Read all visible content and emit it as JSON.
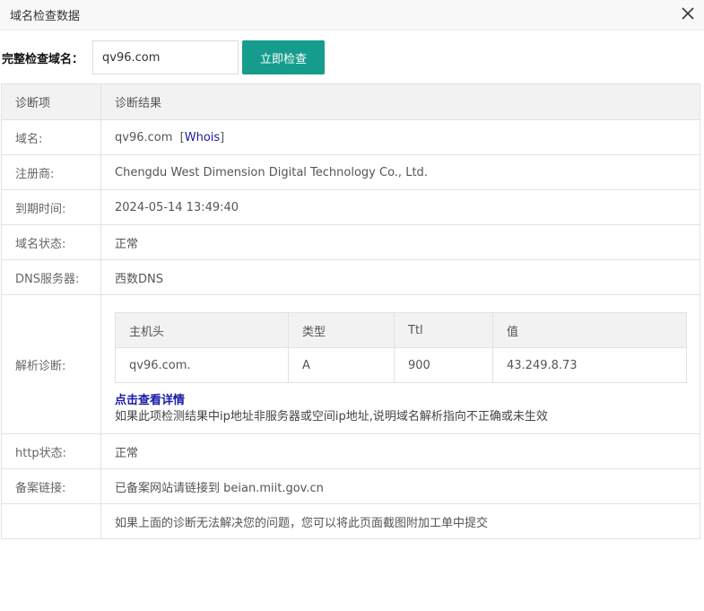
{
  "dialog": {
    "title": "域名检查数据",
    "close_icon": "close-icon"
  },
  "query": {
    "label": "完整检查域名：",
    "domain_value": "qv96.com",
    "button_label": "立即检查",
    "accent_color": "#169c8c"
  },
  "table": {
    "headers": [
      "诊断项",
      "诊断结果"
    ],
    "domain": {
      "label": "域名:",
      "value": "qv96.com",
      "whois_open": "[",
      "whois_label": "Whois",
      "whois_close": "]"
    },
    "registrar": {
      "label": "注册商:",
      "value": "Chengdu West Dimension Digital Technology Co., Ltd."
    },
    "expiry": {
      "label": "到期时间:",
      "value": "2024-05-14 13:49:40"
    },
    "status": {
      "label": "域名状态:",
      "value": "正常",
      "color": "#1b7a1b"
    },
    "dns_server": {
      "label": "DNS服务器:",
      "value": "西数DNS"
    },
    "resolution": {
      "label": "解析诊断:",
      "columns": [
        "主机头",
        "类型",
        "Ttl",
        "值"
      ],
      "rows": [
        {
          "host": "qv96.com.",
          "type": "A",
          "ttl": "900",
          "value": "43.249.8.73"
        }
      ],
      "details_link": "点击查看详情",
      "hint": "如果此项检测结果中ip地址非服务器或空间ip地址,说明域名解析指向不正确或未生效"
    },
    "http_status": {
      "label": "http状态:",
      "value": "正常"
    },
    "beian": {
      "label": "备案链接:",
      "value": "已备案网站请链接到 beian.miit.gov.cn",
      "color": "#c4161c"
    },
    "footer_note": "如果上面的诊断无法解决您的问题，您可以将此页面截图附加工单中提交"
  }
}
